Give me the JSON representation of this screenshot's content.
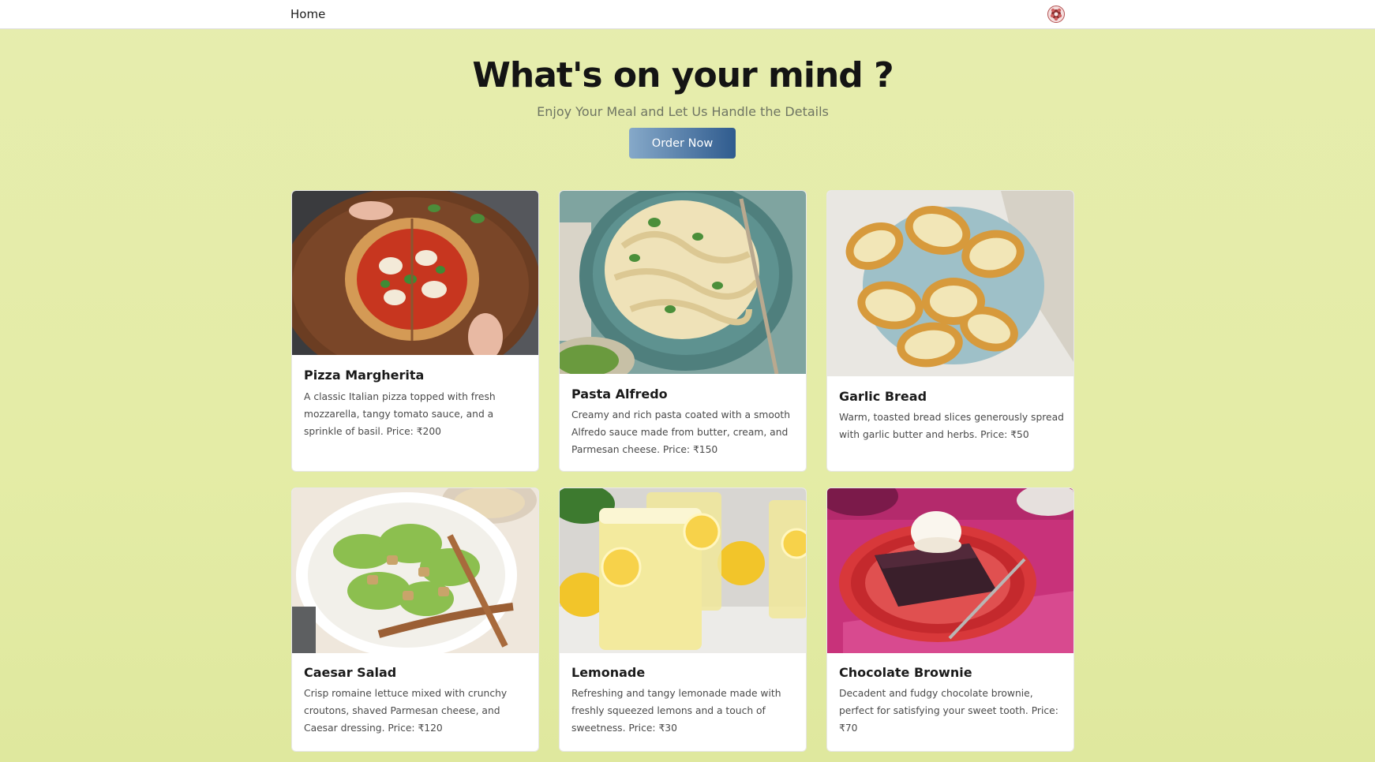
{
  "nav": {
    "home_label": "Home",
    "avatar_icon": "user-avatar-icon"
  },
  "hero": {
    "title": "What's on your mind ?",
    "subtitle": "Enjoy Your Meal and Let Us Handle the Details",
    "order_button": "Order Now"
  },
  "colors": {
    "page_bg": "#e4eca6",
    "button_start": "#86a9c9",
    "button_end": "#2f5b8e"
  },
  "menu": [
    {
      "title": "Pizza Margherita",
      "description": "A classic Italian pizza topped with fresh mozzarella, tangy tomato sauce, and a sprinkle of basil. Price: ₹200",
      "image": "pizza-margherita-photo"
    },
    {
      "title": "Pasta Alfredo",
      "description": "Creamy and rich pasta coated with a smooth Alfredo sauce made from butter, cream, and Parmesan cheese. Price: ₹150",
      "image": "pasta-alfredo-photo"
    },
    {
      "title": "Garlic Bread",
      "description": "Warm, toasted bread slices generously spread with garlic butter and herbs. Price: ₹50",
      "image": "garlic-bread-photo"
    },
    {
      "title": "Caesar Salad",
      "description": "Crisp romaine lettuce mixed with crunchy croutons, shaved Parmesan cheese, and Caesar dressing. Price: ₹120",
      "image": "caesar-salad-photo"
    },
    {
      "title": "Lemonade",
      "description": "Refreshing and tangy lemonade made with freshly squeezed lemons and a touch of sweetness. Price: ₹30",
      "image": "lemonade-photo"
    },
    {
      "title": "Chocolate Brownie",
      "description": "Decadent and fudgy chocolate brownie, perfect for satisfying your sweet tooth. Price: ₹70",
      "image": "chocolate-brownie-photo"
    }
  ]
}
